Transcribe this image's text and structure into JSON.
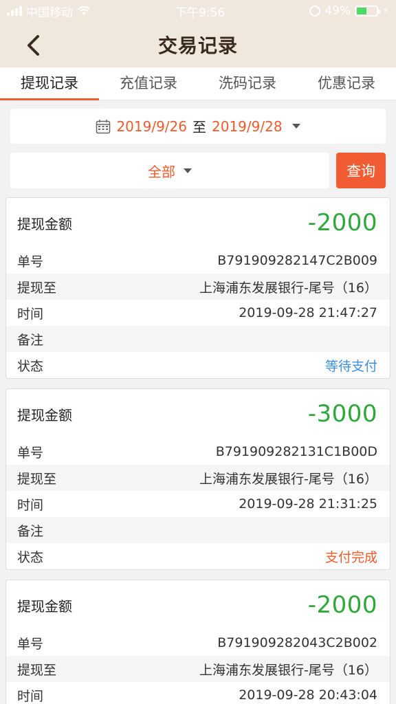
{
  "status_bar": {
    "carrier": "中国移动",
    "time": "下午9:56",
    "battery": "49%",
    "battery_level": 0.49
  },
  "header": {
    "title": "交易记录"
  },
  "tabs": [
    {
      "label": "提现记录"
    },
    {
      "label": "充值记录"
    },
    {
      "label": "洗码记录"
    },
    {
      "label": "优惠记录"
    }
  ],
  "date_filter": {
    "start": "2019/9/26",
    "separator": "至",
    "end": "2019/9/28"
  },
  "type_filter": {
    "selected": "全部"
  },
  "query_button": "查询",
  "colors": {
    "accent": "#f05a2c",
    "header_bg": "#f0e7dd",
    "amount_green": "#2ea83a",
    "status_blue": "#3a8ee6"
  },
  "records": [
    {
      "amount_label": "提现金额",
      "amount": "-2000",
      "order_label": "单号",
      "order": "B791909282147C2B009",
      "to_label": "提现至",
      "to": "上海浦东发展银行-尾号（16）",
      "time_label": "时间",
      "time": "2019-09-28 21:47:27",
      "note_label": "备注",
      "note": "",
      "status_label": "状态",
      "status": "等待支付"
    },
    {
      "amount_label": "提现金额",
      "amount": "-3000",
      "order_label": "单号",
      "order": "B791909282131C1B00D",
      "to_label": "提现至",
      "to": "上海浦东发展银行-尾号（16）",
      "time_label": "时间",
      "time": "2019-09-28 21:31:25",
      "note_label": "备注",
      "note": "",
      "status_label": "状态",
      "status": "支付完成"
    },
    {
      "amount_label": "提现金额",
      "amount": "-2000",
      "order_label": "单号",
      "order": "B791909282043C2B002",
      "to_label": "提现至",
      "to": "上海浦东发展银行-尾号（16）",
      "time_label": "时间",
      "time": "2019-09-28 20:43:04"
    }
  ]
}
